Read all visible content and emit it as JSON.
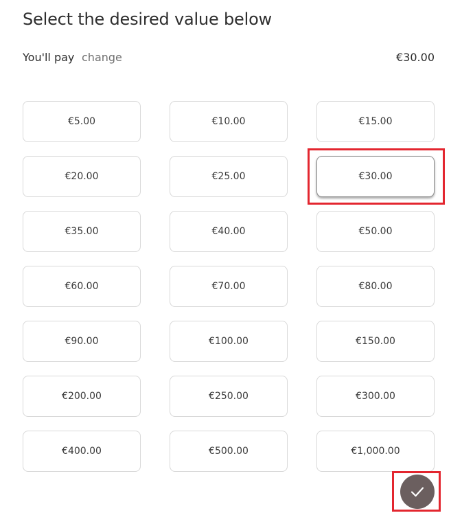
{
  "title": "Select the desired value below",
  "payment": {
    "label": "You'll pay",
    "change_label": "change",
    "amount": "€30.00"
  },
  "amounts": [
    {
      "label": "€5.00",
      "selected": false
    },
    {
      "label": "€10.00",
      "selected": false
    },
    {
      "label": "€15.00",
      "selected": false
    },
    {
      "label": "€20.00",
      "selected": false
    },
    {
      "label": "€25.00",
      "selected": false
    },
    {
      "label": "€30.00",
      "selected": true
    },
    {
      "label": "€35.00",
      "selected": false
    },
    {
      "label": "€40.00",
      "selected": false
    },
    {
      "label": "€50.00",
      "selected": false
    },
    {
      "label": "€60.00",
      "selected": false
    },
    {
      "label": "€70.00",
      "selected": false
    },
    {
      "label": "€80.00",
      "selected": false
    },
    {
      "label": "€90.00",
      "selected": false
    },
    {
      "label": "€100.00",
      "selected": false
    },
    {
      "label": "€150.00",
      "selected": false
    },
    {
      "label": "€200.00",
      "selected": false
    },
    {
      "label": "€250.00",
      "selected": false
    },
    {
      "label": "€300.00",
      "selected": false
    },
    {
      "label": "€400.00",
      "selected": false
    },
    {
      "label": "€500.00",
      "selected": false
    },
    {
      "label": "€1,000.00",
      "selected": false
    }
  ],
  "confirm": {
    "icon": "check-icon"
  },
  "colors": {
    "highlight": "#e3262f",
    "confirm_bg": "#6b5f5f"
  }
}
